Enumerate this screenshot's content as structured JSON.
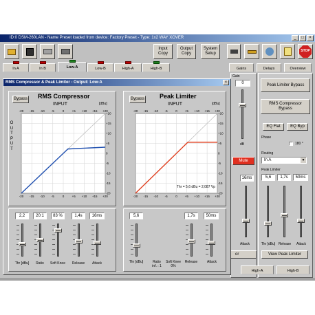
{
  "window": {
    "title": "ID:0 DSM-260LAN - Name Preset loaded from device: Factory Preset - Type: 1x2 WAY XOVER"
  },
  "toolbar": {
    "input_copy": "Input\nCopy",
    "output_copy": "Output\nCopy",
    "system_setup": "System\nSetup",
    "stop_label": "STOP"
  },
  "tabs": [
    "In A",
    "In B",
    "Low-A",
    "Low-B",
    "High-A",
    "High-B"
  ],
  "right_tabs": [
    "Gains",
    "Delays",
    "Overview"
  ],
  "dialog": {
    "title": "RMS Compressor & Peak Limiter - Output: Low-A"
  },
  "rms": {
    "title": "RMS Compressor",
    "bypass": "Bypass",
    "input_label": "INPUT",
    "unit": "[dBu]",
    "output_label": "OUTPUT",
    "values": [
      "2,2",
      "20:1",
      "83 %",
      "1,4s",
      "16ms"
    ],
    "fader_labels": [
      "Thr [dBu]",
      "Ratio",
      "Soft Knee",
      "Release",
      "Attack"
    ],
    "fader_levels": [
      0.35,
      0.5,
      0.83,
      0.45,
      0.4
    ]
  },
  "peak": {
    "title": "Peak Limiter",
    "bypass": "Bypass",
    "input_label": "INPUT",
    "unit": "[dBu]",
    "annotation": "Thr = 5,6 dBu = 2,087 Vp",
    "values": [
      "5,6",
      "1,7s",
      "50ms"
    ],
    "fader_labels": [
      "Thr [dBu]",
      "Ratio\ninf. : 1",
      "Soft Knee\n0%",
      "Release",
      "Attack"
    ],
    "fader_levels": [
      0.3,
      0.45,
      0.4
    ]
  },
  "axis": {
    "x_ticks": [
      "-20",
      "-15",
      "-10",
      "-5",
      "0",
      "+5",
      "+10",
      "+15",
      "+20"
    ],
    "y_ticks": [
      "+20",
      "+15",
      "+10",
      "+5",
      "0",
      "-5",
      "-10",
      "-15",
      "-20"
    ]
  },
  "right_panel": {
    "gain_label": "Gain",
    "gain_value": "0",
    "db_label": "dB",
    "mute": "Mute",
    "peak_limiter_bypass": "Peak Limiter Bypass",
    "rms_compressor_bypass": "RMS Compressor\nBypass",
    "eq_flat": "EQ Flat",
    "eq_byp": "EQ Byp",
    "phase_label": "Phase",
    "phase_value": "180 °",
    "routing_label": "Routing",
    "routing_value": "In A",
    "peak_limiter_label": "Peak Limiter",
    "pl_values": [
      "5,6",
      "1,7s",
      "50ms"
    ],
    "pl_faders": [
      "Thr [dBu]",
      "Release",
      "Attack"
    ],
    "view_peak_limiter": "View Peak Limiter",
    "partial_ms": "16ms",
    "partial_or": "or",
    "partial_fader": [
      "Thr",
      "Attack"
    ],
    "bottom_tabs": [
      "High-A",
      "High-B"
    ]
  },
  "chart_data": [
    {
      "type": "line",
      "title": "RMS Compressor",
      "xlabel": "INPUT",
      "ylabel": "OUTPUT",
      "xlim": [
        -20,
        20
      ],
      "ylim": [
        -20,
        20
      ],
      "series": [
        {
          "values": [
            [
              -20,
              -20
            ],
            [
              0,
              0
            ],
            [
              2.2,
              2.2
            ],
            [
              20,
              3.1
            ]
          ]
        }
      ]
    },
    {
      "type": "line",
      "title": "Peak Limiter",
      "xlabel": "INPUT",
      "ylabel": "OUTPUT",
      "xlim": [
        -20,
        20
      ],
      "ylim": [
        -20,
        20
      ],
      "series": [
        {
          "values": [
            [
              -20,
              -20
            ],
            [
              5.6,
              5.6
            ],
            [
              20,
              5.6
            ]
          ]
        }
      ]
    }
  ],
  "colors": {
    "rms_line": "#2050b0",
    "peak_line": "#e04020",
    "unity": "#c0c0c0"
  }
}
